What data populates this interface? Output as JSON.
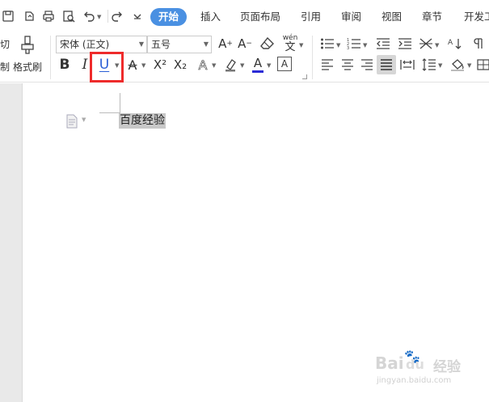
{
  "tabs": [
    {
      "label": "开始",
      "active": true
    },
    {
      "label": "插入"
    },
    {
      "label": "页面布局"
    },
    {
      "label": "引用"
    },
    {
      "label": "审阅"
    },
    {
      "label": "视图"
    },
    {
      "label": "章节"
    },
    {
      "label": "开发工"
    }
  ],
  "clipboard": {
    "cut_label_fragment": "切",
    "copy_label_fragment": "制",
    "format_painter_label": "格式刷"
  },
  "font": {
    "family_value": "宋体 (正文)",
    "size_value": "五号",
    "bold_glyph": "B",
    "italic_glyph": "I",
    "underline_glyph": "U",
    "strike_glyph": "A",
    "superscript_glyph": "X²",
    "subscript_glyph": "X₂",
    "effect_glyph": "A",
    "font_color_glyph": "A",
    "char_border_glyph": "A",
    "pinyin_glyph": "wén",
    "pinyin_base": "文"
  },
  "document": {
    "text": "百度经验"
  },
  "watermark": {
    "brand": "Bai",
    "brand_du": "du",
    "suffix": "经验",
    "domain": "jingyan.baidu.com"
  },
  "colors": {
    "accent": "#4a90e2",
    "highlight_box": "#ee2b2b",
    "font_color_bar": "#2b2bd6",
    "underline_blue": "#2b5fd6"
  }
}
